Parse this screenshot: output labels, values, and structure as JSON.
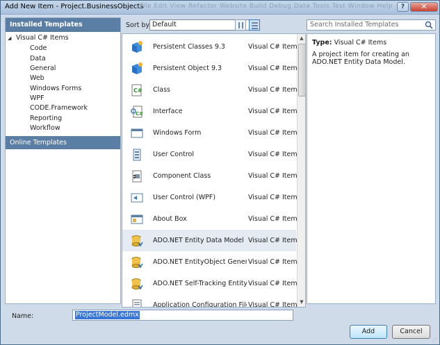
{
  "window": {
    "title": "Add New Item - Project.BusinessObjects",
    "ghost_menu": "File  Edit  View  Refactor  Website  Build  Debug  Data  Tools  Test  Window  Help"
  },
  "left_panel": {
    "header": "Installed Templates",
    "root": "Visual C# Items",
    "children": [
      "Code",
      "Data",
      "General",
      "Web",
      "Windows Forms",
      "WPF",
      "CODE.Framework",
      "Reporting",
      "Workflow"
    ],
    "online": "Online Templates"
  },
  "toolbar": {
    "sort_label": "Sort by:",
    "sort_value": "Default",
    "search_placeholder": "Search Installed Templates"
  },
  "templates": [
    {
      "name": "Persistent Classes 9.3",
      "category": "Visual C# Items",
      "icon": "persistent-classes-icon"
    },
    {
      "name": "Persistent Object 9.3",
      "category": "Visual C# Items",
      "icon": "persistent-object-icon"
    },
    {
      "name": "Class",
      "category": "Visual C# Items",
      "icon": "class-icon"
    },
    {
      "name": "Interface",
      "category": "Visual C# Items",
      "icon": "interface-icon"
    },
    {
      "name": "Windows Form",
      "category": "Visual C# Items",
      "icon": "windows-form-icon"
    },
    {
      "name": "User Control",
      "category": "Visual C# Items",
      "icon": "user-control-icon"
    },
    {
      "name": "Component Class",
      "category": "Visual C# Items",
      "icon": "component-class-icon"
    },
    {
      "name": "User Control (WPF)",
      "category": "Visual C# Items",
      "icon": "wpf-user-control-icon"
    },
    {
      "name": "About Box",
      "category": "Visual C# Items",
      "icon": "about-box-icon"
    },
    {
      "name": "ADO.NET Entity Data Model",
      "category": "Visual C# Items",
      "icon": "entity-data-model-icon"
    },
    {
      "name": "ADO.NET EntityObject Generator",
      "category": "Visual C# Items",
      "icon": "entityobject-generator-icon"
    },
    {
      "name": "ADO.NET Self-Tracking Entity Ge...",
      "category": "Visual C# Items",
      "icon": "self-tracking-entity-icon"
    },
    {
      "name": "Application Configuration File",
      "category": "Visual C# Items",
      "icon": "config-file-icon"
    }
  ],
  "selected_index": 9,
  "details": {
    "type_label": "Type:",
    "type_value": "Visual C# Items",
    "description": "A project item for creating an ADO.NET Entity Data Model."
  },
  "name_field": {
    "label": "Name:",
    "value": "ProjectModel.edmx"
  },
  "buttons": {
    "add": "Add",
    "cancel": "Cancel"
  },
  "colors": {
    "header_blue": "#5a7ea4",
    "frame": "#cfdbe9",
    "selection": "#3875d7"
  }
}
